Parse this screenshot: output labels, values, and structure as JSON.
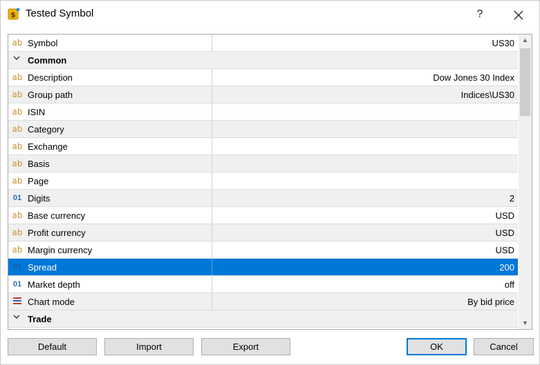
{
  "window": {
    "title": "Tested Symbol",
    "help_label": "?",
    "close_label": "✕"
  },
  "rows": [
    {
      "type": "text",
      "name": "Symbol",
      "value": "US30"
    },
    {
      "type": "group",
      "name": "Common",
      "expanded": true
    },
    {
      "type": "text",
      "name": "Description",
      "value": "Dow Jones 30 Index"
    },
    {
      "type": "text",
      "name": "Group path",
      "value": "Indices\\US30"
    },
    {
      "type": "text",
      "name": "ISIN",
      "value": ""
    },
    {
      "type": "text",
      "name": "Category",
      "value": ""
    },
    {
      "type": "text",
      "name": "Exchange",
      "value": ""
    },
    {
      "type": "text",
      "name": "Basis",
      "value": ""
    },
    {
      "type": "text",
      "name": "Page",
      "value": ""
    },
    {
      "type": "number",
      "name": "Digits",
      "value": "2"
    },
    {
      "type": "text",
      "name": "Base currency",
      "value": "USD"
    },
    {
      "type": "text",
      "name": "Profit currency",
      "value": "USD"
    },
    {
      "type": "text",
      "name": "Margin currency",
      "value": "USD"
    },
    {
      "type": "number",
      "name": "Spread",
      "value": "200",
      "selected": true
    },
    {
      "type": "number",
      "name": "Market depth",
      "value": "off"
    },
    {
      "type": "chart",
      "name": "Chart mode",
      "value": "By bid price"
    },
    {
      "type": "group",
      "name": "Trade",
      "expanded": true
    }
  ],
  "icons": {
    "text": "ab",
    "number": "01"
  },
  "buttons": {
    "default": "Default",
    "import": "Import",
    "export": "Export",
    "ok": "OK",
    "cancel": "Cancel"
  },
  "colors": {
    "selection": "#0078d7",
    "accent": "#0078d7"
  }
}
